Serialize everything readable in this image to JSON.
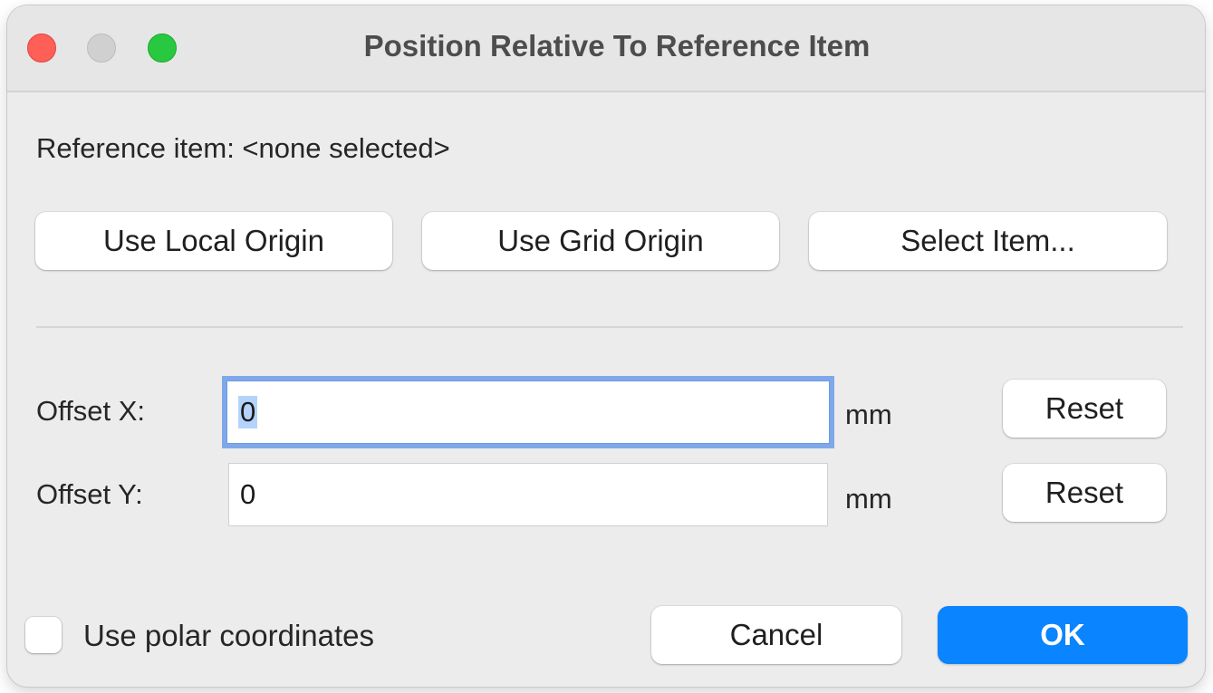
{
  "window": {
    "title": "Position Relative To Reference Item"
  },
  "reference": {
    "label": "Reference item: <none selected>"
  },
  "origin_buttons": {
    "local": "Use Local Origin",
    "grid": "Use Grid Origin",
    "select": "Select Item..."
  },
  "offset_x": {
    "label": "Offset X:",
    "value": "0",
    "unit": "mm",
    "reset": "Reset"
  },
  "offset_y": {
    "label": "Offset Y:",
    "value": "0",
    "unit": "mm",
    "reset": "Reset"
  },
  "polar": {
    "label": "Use polar coordinates",
    "checked": false
  },
  "footer": {
    "cancel": "Cancel",
    "ok": "OK"
  },
  "colors": {
    "accent": "#0a84ff",
    "close": "#fe5f57",
    "maximize": "#28c840",
    "focus_ring": "#7fa8ea"
  }
}
